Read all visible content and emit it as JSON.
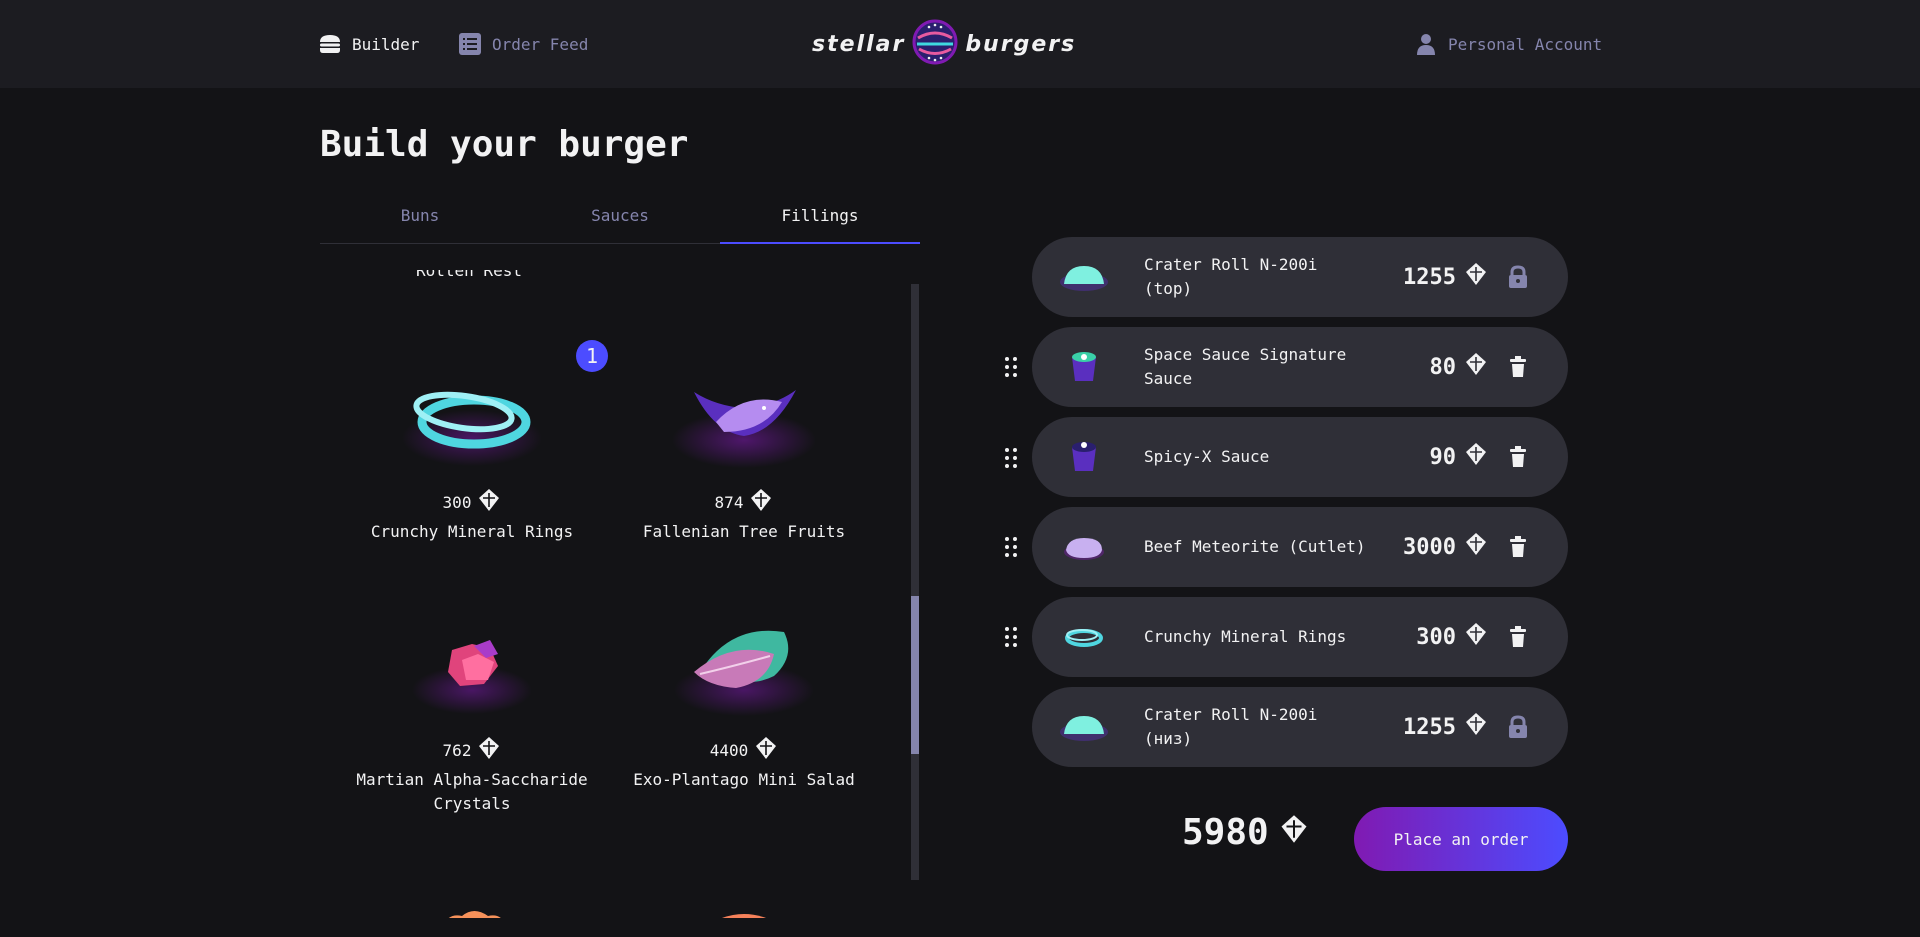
{
  "header": {
    "nav_builder": "Builder",
    "nav_order_feed": "Order Feed",
    "nav_account": "Personal Account",
    "logo_left": "stellar",
    "logo_right": "burgers"
  },
  "page_title": "Build your burger",
  "tabs": [
    {
      "label": "Buns",
      "active": false
    },
    {
      "label": "Sauces",
      "active": false
    },
    {
      "label": "Fillings",
      "active": true
    }
  ],
  "list": {
    "cut_off_label": "Rotten Rest",
    "counter": "1",
    "cards": [
      {
        "price": "300",
        "name": "Crunchy Mineral Rings"
      },
      {
        "price": "874",
        "name": "Fallenian Tree Fruits"
      },
      {
        "price": "762",
        "name": "Martian Alpha-Saccharide Crystals"
      },
      {
        "price": "4400",
        "name": "Exo-Plantago Mini Salad"
      }
    ]
  },
  "constructor": {
    "items": [
      {
        "name": "Crater Roll N-200i (top)",
        "price": "1255",
        "locked": true
      },
      {
        "name": "Space Sauce Signature Sauce",
        "price": "80",
        "locked": false
      },
      {
        "name": "Spicy-X Sauce",
        "price": "90",
        "locked": false
      },
      {
        "name": "Beef Meteorite (Cutlet)",
        "price": "3000",
        "locked": false
      },
      {
        "name": "Crunchy Mineral Rings",
        "price": "300",
        "locked": false
      },
      {
        "name": "Crater Roll N-200i (низ)",
        "price": "1255",
        "locked": true
      }
    ],
    "total": "5980",
    "order_button": "Place an order"
  },
  "colors": {
    "accent": "#4c4cff",
    "inactive_text": "#8585ad",
    "card_bg": "#2f2f37",
    "header_bg": "#1c1c21"
  }
}
